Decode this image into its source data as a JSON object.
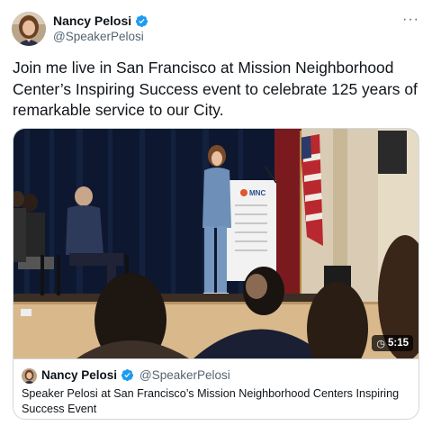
{
  "author": {
    "display_name": "Nancy Pelosi",
    "handle": "@SpeakerPelosi",
    "verified_icon": "verified-badge-icon",
    "avatar_icon": "profile-photo"
  },
  "more_menu": {
    "label": "···",
    "icon": "more-options-icon"
  },
  "tweet": {
    "text": "Join me live in San Francisco at Mission Neighborhood Center’s Inspiring Success event to celebrate 125 years of remarkable service to our City."
  },
  "video": {
    "duration": "5:15",
    "duration_icon": "replay-clock-icon",
    "podium_sign": "MNC"
  },
  "quoted": {
    "display_name": "Nancy Pelosi",
    "handle": "@SpeakerPelosi",
    "text": "Speaker Pelosi at San Francisco’s Mission Neighborhood Centers Inspiring Success Event"
  },
  "colors": {
    "text_primary": "#0f1419",
    "text_secondary": "#536471",
    "verified_blue": "#1d9bf0",
    "border": "#cfd9de"
  }
}
